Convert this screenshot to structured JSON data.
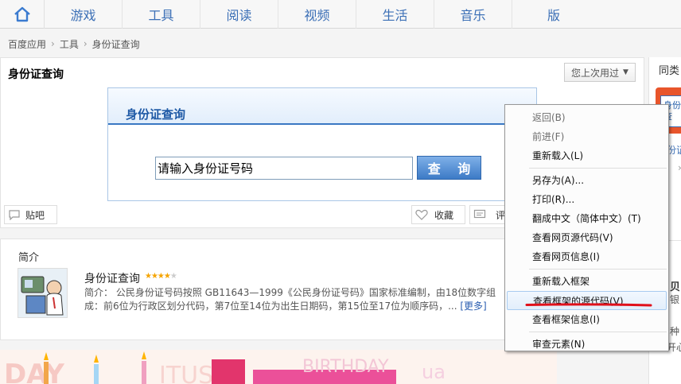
{
  "topnav": {
    "items": [
      "游戏",
      "工具",
      "阅读",
      "视频",
      "生活",
      "音乐",
      "版"
    ]
  },
  "breadcrumb": [
    "百度应用",
    "工具",
    "身份证查询"
  ],
  "main": {
    "title": "身份证查询",
    "last_used": "您上次用过",
    "widget_title": "身份证查询",
    "input_value": "请输入身份证号码",
    "query_button": "查 询",
    "tiebar": "贴吧",
    "favorite": "收藏",
    "comment": "评"
  },
  "intro": {
    "heading": "简介",
    "name": "身份证查询",
    "rating": 4,
    "desc_label": "简介：",
    "desc": "公民身份证号码按照 GB11643—1999《公民身份证号码》国家标准编制，由18位数字组成：前6位为行政区划分代码，第7位至14位为出生日期码，第15位至17位为顺序码，...",
    "more": "[更多]"
  },
  "right": {
    "label1": "同类",
    "label2": "身份",
    "label3": "查",
    "label4": "份证",
    "label5": "贝",
    "label6": "银",
    "label7": "种",
    "label8": "开心"
  },
  "context_menu": {
    "items": [
      {
        "label": "返回(B)",
        "disabled": true
      },
      {
        "label": "前进(F)",
        "disabled": true
      },
      {
        "label": "重新载入(L)"
      },
      {
        "label": "另存为(A)..."
      },
      {
        "label": "打印(R)..."
      },
      {
        "label": "翻成中文（简体中文）(T)"
      },
      {
        "label": "查看网页源代码(V)"
      },
      {
        "label": "查看网页信息(I)"
      },
      {
        "label": "重新载入框架"
      },
      {
        "label": "查看框架的源代码(V)",
        "highlighted": true
      },
      {
        "label": "查看框架信息(I)"
      },
      {
        "label": "审查元素(N)"
      }
    ]
  },
  "colors": {
    "accent_blue": "#3a78c3",
    "link_blue": "#3b6fb6",
    "annotation_red": "#e0101a"
  }
}
